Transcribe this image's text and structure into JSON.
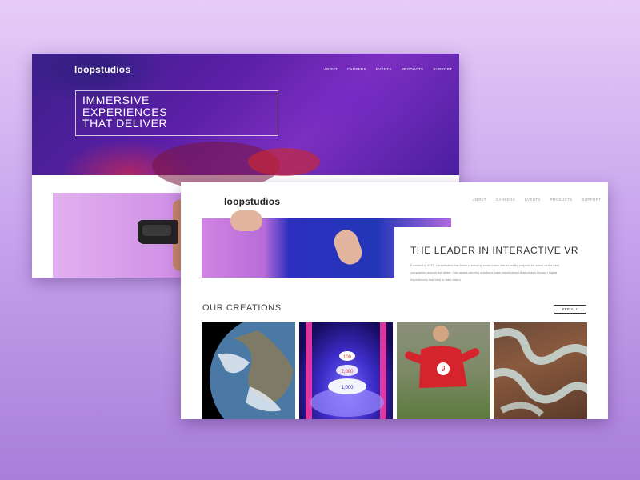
{
  "back_window": {
    "logo": "loopstudios",
    "nav": [
      "ABOUT",
      "CAREERS",
      "EVENTS",
      "PRODUCTS",
      "SUPPORT"
    ],
    "hero_lines": [
      "IMMERSIVE",
      "EXPERIENCES",
      "THAT DELIVER"
    ]
  },
  "front_window": {
    "logo": "loopstudios",
    "nav": [
      "ABOUT",
      "CAREERS",
      "EVENTS",
      "PRODUCTS",
      "SUPPORT"
    ],
    "leader_title": "THE LEADER IN INTERACTIVE VR",
    "leader_text": "Founded in 2011, Loopstudios has been producing world-class virtual reality projects for some of the best companies around the globe. Our award-winning creations have transformed businesses through digital experiences that bind to their brand.",
    "creations_title": "OUR CREATIONS",
    "see_all": "SEE ALL",
    "creations": [
      {
        "icon": "earth-image"
      },
      {
        "icon": "arcade-image",
        "badges": [
          "100",
          "2,000",
          "1,000"
        ]
      },
      {
        "icon": "soccer-image",
        "number": "9"
      },
      {
        "icon": "curves-image"
      }
    ]
  },
  "colors": {
    "brand_purple": "#5b1fa6",
    "background_top": "#e6ccf7",
    "background_bottom": "#a87ed9"
  }
}
